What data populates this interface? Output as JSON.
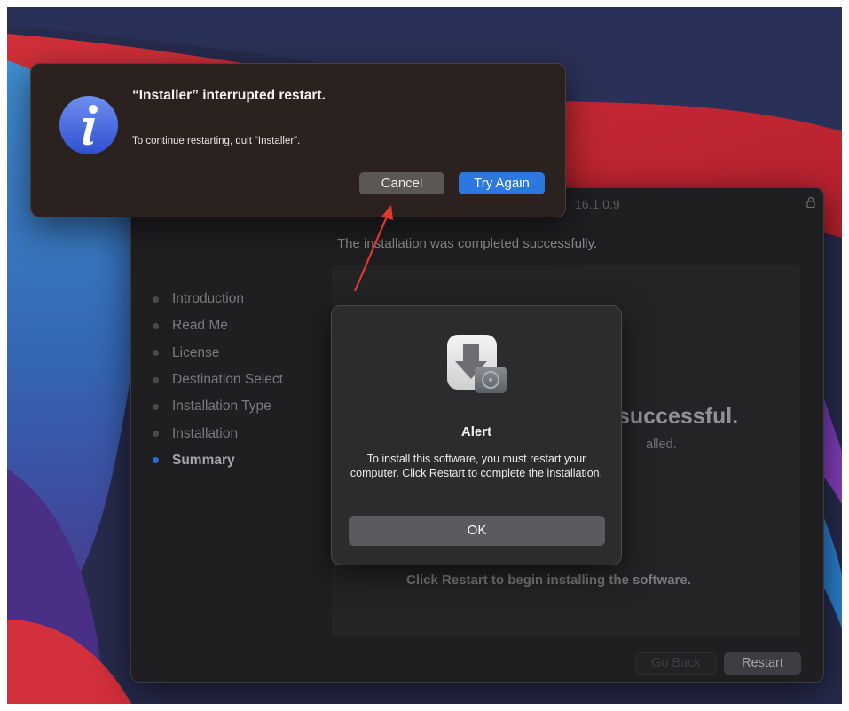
{
  "interrupt_dialog": {
    "title": "“Installer” interrupted restart.",
    "message": "To continue restarting, quit “Installer”.",
    "cancel_label": "Cancel",
    "try_again_label": "Try Again",
    "icon": "info-icon"
  },
  "installer": {
    "title": "16.1.0.9",
    "headline": "The installation was completed successfully.",
    "steps": [
      {
        "label": "Introduction"
      },
      {
        "label": "Read Me"
      },
      {
        "label": "License"
      },
      {
        "label": "Destination Select"
      },
      {
        "label": "Installation Type"
      },
      {
        "label": "Installation"
      },
      {
        "label": "Summary",
        "active": true
      }
    ],
    "status_big": "successful.",
    "status_sub": "alled.",
    "restart_hint": "Click Restart to begin installing the software.",
    "go_back_label": "Go Back",
    "restart_label": "Restart"
  },
  "alert": {
    "title": "Alert",
    "message": "To install this software, you must restart your computer. Click Restart to complete the installation.",
    "ok_label": "OK",
    "icon": "installer-icon"
  },
  "colors": {
    "accent_blue": "#2c78e0",
    "arrow_red": "#e0392b",
    "wallpaper_red": "#cf2a31",
    "wallpaper_blue": "#2f73b8"
  }
}
